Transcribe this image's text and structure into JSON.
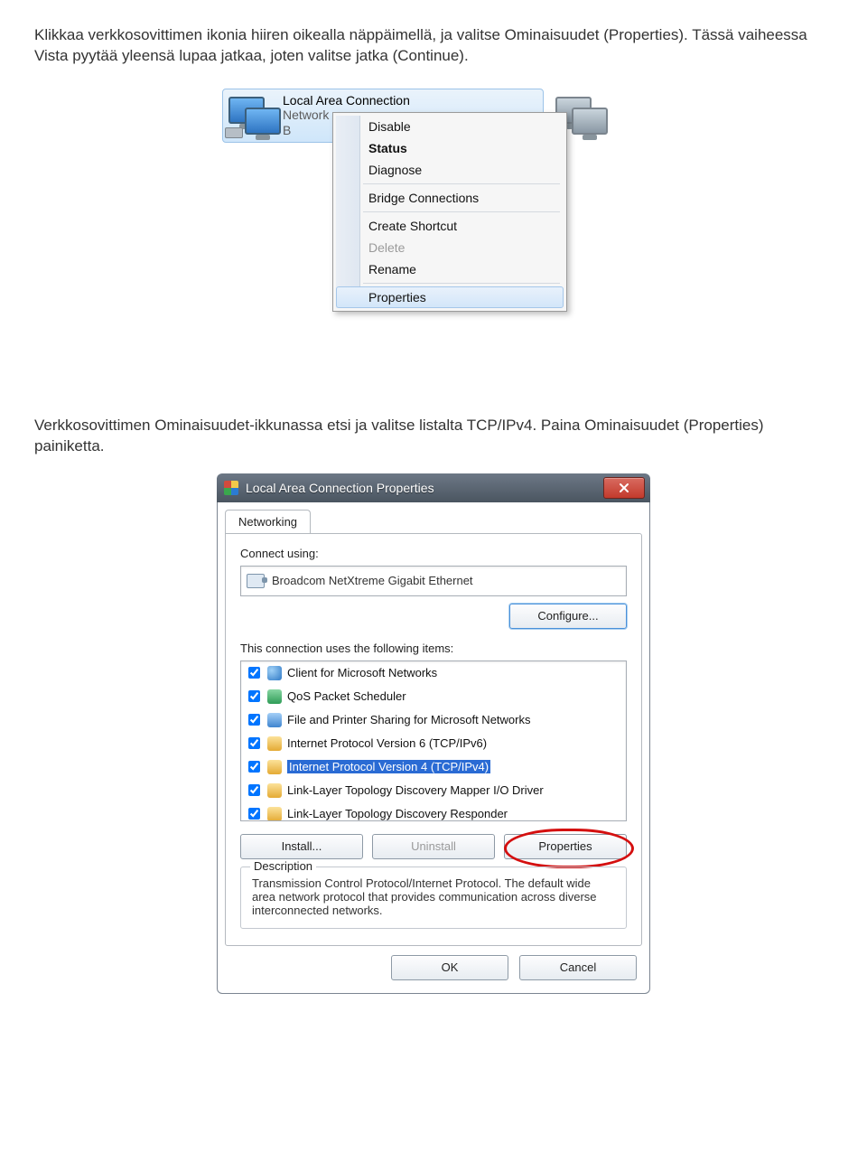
{
  "para1": "Klikkaa verkkosovittimen ikonia hiiren oikealla näppäimellä, ja valitse Ominaisuudet (Properties). Tässä vaiheessa Vista pyytää yleensä lupaa jatkaa, joten valitse jatka (Continue).",
  "para2": "Verkkosovittimen Ominaisuudet-ikkunassa etsi ja valitse listalta TCP/IPv4. Paina Ominaisuudet (Properties) painiketta.",
  "adapter": {
    "name": "Local Area Connection",
    "sub1": "Network",
    "sub2": "B"
  },
  "menu": {
    "disable": "Disable",
    "status": "Status",
    "diagnose": "Diagnose",
    "bridge": "Bridge Connections",
    "shortcut": "Create Shortcut",
    "delete": "Delete",
    "rename": "Rename",
    "properties": "Properties"
  },
  "dialog": {
    "title": "Local Area Connection  Properties",
    "tab": "Networking",
    "connect_using": "Connect using:",
    "nic": "Broadcom NetXtreme Gigabit Ethernet",
    "configure": "Configure...",
    "items_label": "This connection uses the following items:",
    "items": [
      "Client for Microsoft Networks",
      "QoS Packet Scheduler",
      "File and Printer Sharing for Microsoft Networks",
      "Internet Protocol Version 6 (TCP/IPv6)",
      "Internet Protocol Version 4 (TCP/IPv4)",
      "Link-Layer Topology Discovery Mapper I/O Driver",
      "Link-Layer Topology Discovery Responder"
    ],
    "install": "Install...",
    "uninstall": "Uninstall",
    "properties": "Properties",
    "desc_label": "Description",
    "desc": "Transmission Control Protocol/Internet Protocol. The default wide area network protocol that provides communication across diverse interconnected networks.",
    "ok": "OK",
    "cancel": "Cancel"
  }
}
